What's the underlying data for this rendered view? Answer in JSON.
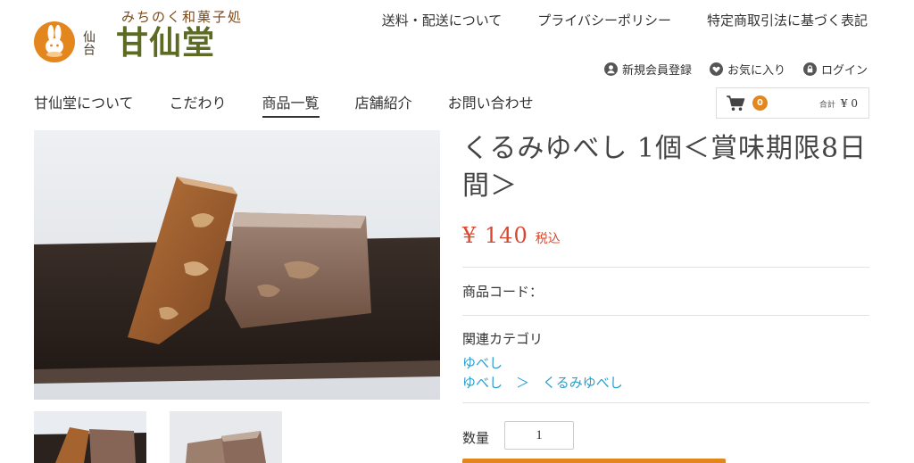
{
  "header": {
    "logo_tagline": "みちのく和菓子処",
    "logo_sub": "仙台",
    "logo_name": "甘仙堂",
    "top_links": [
      "送料・配送について",
      "プライバシーポリシー",
      "特定商取引法に基づく表記"
    ],
    "user_links": [
      {
        "label": "新規会員登録",
        "icon": "user-icon"
      },
      {
        "label": "お気に入り",
        "icon": "heart-icon"
      },
      {
        "label": "ログイン",
        "icon": "lock-icon"
      }
    ],
    "nav": [
      "甘仙堂について",
      "こだわり",
      "商品一覧",
      "店舗紹介",
      "お問い合わせ"
    ],
    "nav_active": "商品一覧",
    "cart": {
      "count": "0",
      "total_label": "合計",
      "total_value": "¥ 0",
      "icon": "cart-icon"
    }
  },
  "product": {
    "title": "くるみゆべし 1個＜賞味期限8日間＞",
    "price": "¥ 140",
    "tax_label": "税込",
    "code_label": "商品コード：",
    "category_label": "関連カテゴリ",
    "category_link_1": "ゆべし",
    "category_path": "ゆべし　＞　くるみゆべし",
    "quantity_label": "数量",
    "quantity_value": "1"
  },
  "colors": {
    "accent": "#e4861e",
    "price": "#d9472f",
    "link": "#2a9fd0",
    "logo_green": "#5c6a22"
  }
}
